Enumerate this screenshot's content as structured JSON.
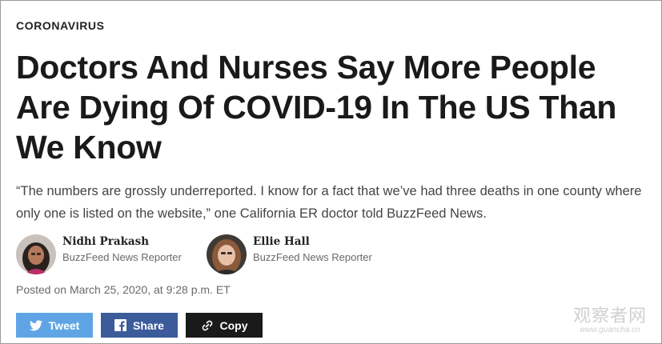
{
  "article": {
    "section": "CORONAVIRUS",
    "headline": "Doctors And Nurses Say More People Are Dying Of COVID-19 In The US Than We Know",
    "dek": "“The numbers are grossly underreported. I know for a fact that we’ve had three deaths in one county where only one is listed on the website,” one California ER doctor told BuzzFeed News.",
    "authors": [
      {
        "name": "Nidhi Prakash",
        "role": "BuzzFeed News Reporter"
      },
      {
        "name": "Ellie Hall",
        "role": "BuzzFeed News Reporter"
      }
    ],
    "posted": "Posted on March 25, 2020, at 9:28 p.m. ET"
  },
  "share": {
    "tweet_label": "Tweet",
    "share_label": "Share",
    "copy_label": "Copy"
  },
  "watermark": {
    "text": "观察者网",
    "url": "www.guancha.cn"
  },
  "colors": {
    "twitter": "#5fa5e6",
    "facebook": "#3b5b9a",
    "copy": "#1a1a1a"
  },
  "icons": [
    "twitter-bird-icon",
    "facebook-icon",
    "link-icon"
  ]
}
